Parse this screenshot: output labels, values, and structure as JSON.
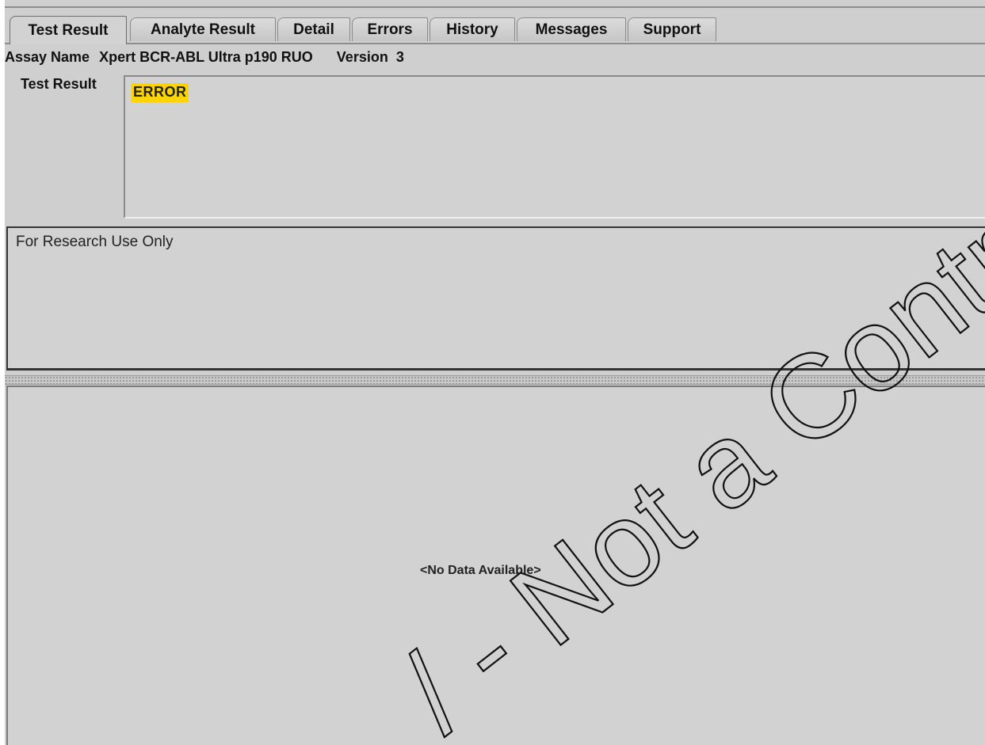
{
  "tabs": [
    {
      "label": "Test Result",
      "active": true
    },
    {
      "label": "Analyte Result",
      "active": false
    },
    {
      "label": "Detail",
      "active": false
    },
    {
      "label": "Errors",
      "active": false
    },
    {
      "label": "History",
      "active": false
    },
    {
      "label": "Messages",
      "active": false
    },
    {
      "label": "Support",
      "active": false
    }
  ],
  "assay": {
    "name_label": "Assay Name",
    "name_value": "Xpert BCR-ABL Ultra p190 RUO",
    "version_label": "Version",
    "version_value": "3"
  },
  "test_result": {
    "label": "Test Result",
    "value": "ERROR",
    "highlight_color": "#ffd400"
  },
  "notice": {
    "text": "For Research Use Only"
  },
  "lower_panel": {
    "empty_text": "<No Data Available>"
  },
  "watermark": {
    "text": "Copy - Not a Controlled Copy",
    "visible_fragment": "/ - Not a Controlled Copy"
  }
}
